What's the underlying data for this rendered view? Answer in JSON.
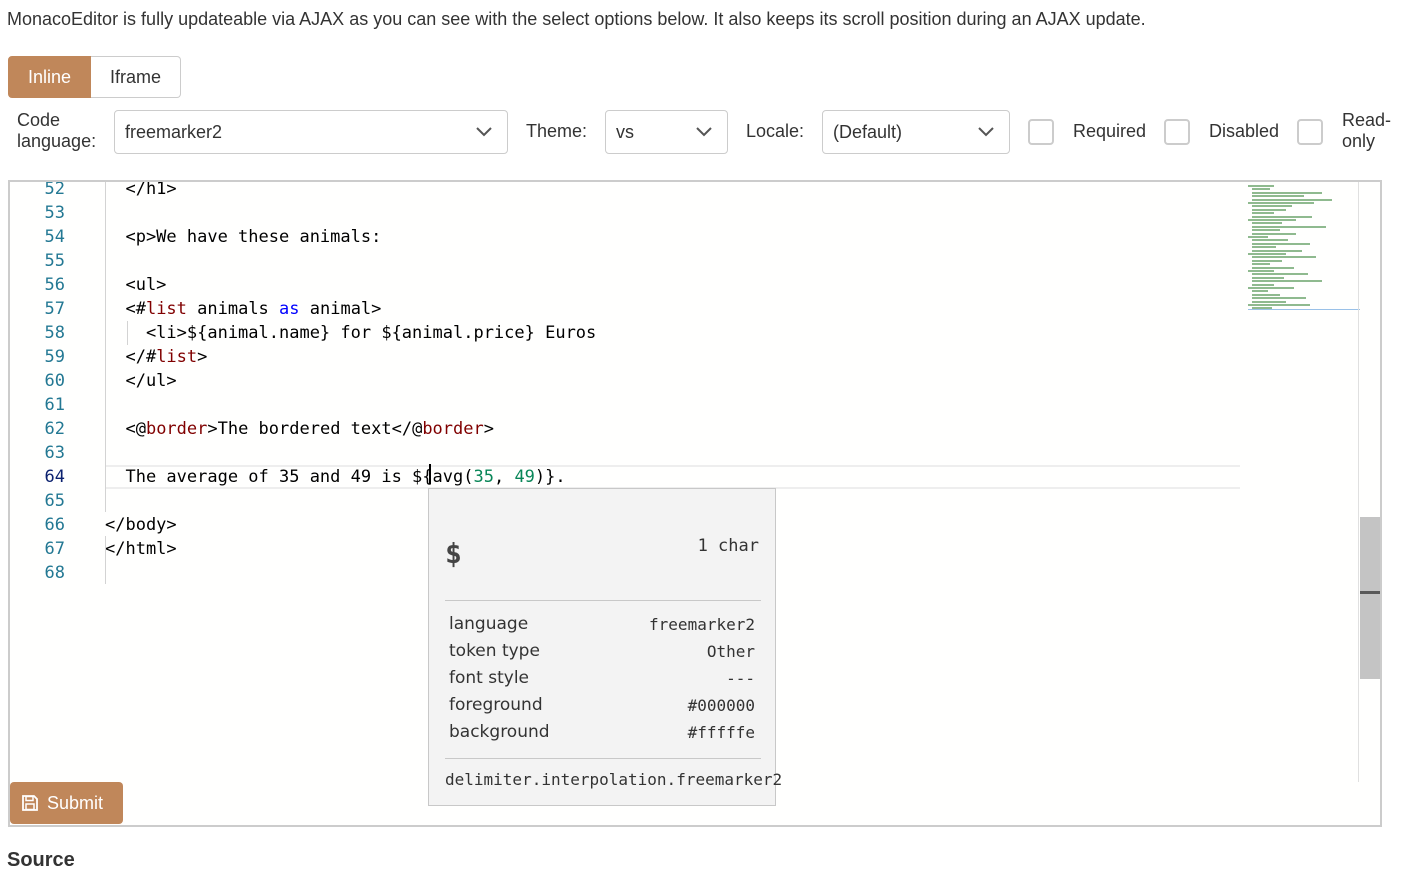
{
  "intro_text": "MonacoEditor is fully updateable via AJAX as you can see with the select options below. It also keeps its scroll position during an AJAX update.",
  "mode_buttons": [
    {
      "label": "Inline",
      "active": true
    },
    {
      "label": "Iframe",
      "active": false
    }
  ],
  "toolbar": {
    "code_language_label_1": "Code",
    "code_language_label_2": "language:",
    "code_language_value": "freemarker2",
    "theme_label": "Theme:",
    "theme_value": "vs",
    "locale_label": "Locale:",
    "locale_value": "(Default)",
    "required_label": "Required",
    "disabled_label": "Disabled",
    "readonly_label_1": "Read-",
    "readonly_label_2": "only",
    "required_checked": false,
    "disabled_checked": false,
    "readonly_checked": false
  },
  "editor": {
    "current_line": 64,
    "lines": [
      {
        "n": "52",
        "html": "  &lt;/h1&gt;"
      },
      {
        "n": "53",
        "html": ""
      },
      {
        "n": "54",
        "html": "  &lt;p&gt;We have these animals:"
      },
      {
        "n": "55",
        "html": ""
      },
      {
        "n": "56",
        "html": "  &lt;ul&gt;"
      },
      {
        "n": "57",
        "html": "  &lt;#<span class=\"kw\">list</span> animals <span class=\"blue\">as</span> animal&gt;"
      },
      {
        "n": "58",
        "html": "    &lt;li&gt;${animal.name} for ${animal.price} Euros"
      },
      {
        "n": "59",
        "html": "  &lt;/#<span class=\"kw\">list</span>&gt;"
      },
      {
        "n": "60",
        "html": "  &lt;/ul&gt;"
      },
      {
        "n": "61",
        "html": ""
      },
      {
        "n": "62",
        "html": "  &lt;@<span class=\"kw\">border</span>&gt;The bordered text&lt;/@<span class=\"kw\">border</span>&gt;"
      },
      {
        "n": "63",
        "html": ""
      },
      {
        "n": "64",
        "html": "  The average of 35 and 49 is ${avg(<span class=\"num-lit\">35</span>, <span class=\"num-lit\">49</span>)}."
      },
      {
        "n": "65",
        "html": ""
      },
      {
        "n": "66",
        "html": "&lt;/body&gt;"
      },
      {
        "n": "67",
        "html": "&lt;/html&gt;"
      },
      {
        "n": "68",
        "html": ""
      }
    ]
  },
  "hover": {
    "char": "$",
    "char_count": "1 char",
    "rows": [
      {
        "key": "language",
        "value": "freemarker2"
      },
      {
        "key": "token type",
        "value": "Other"
      },
      {
        "key": "font style",
        "value": "---"
      },
      {
        "key": "foreground",
        "value": "#000000"
      },
      {
        "key": "background",
        "value": "#fffffe"
      }
    ],
    "scope": "delimiter.interpolation.freemarker2"
  },
  "submit_label": "Submit",
  "source_heading": "Source",
  "colors": {
    "accent": "#c0875a",
    "line_number": "#237893",
    "keyword": "#800000",
    "number": "#098658"
  }
}
